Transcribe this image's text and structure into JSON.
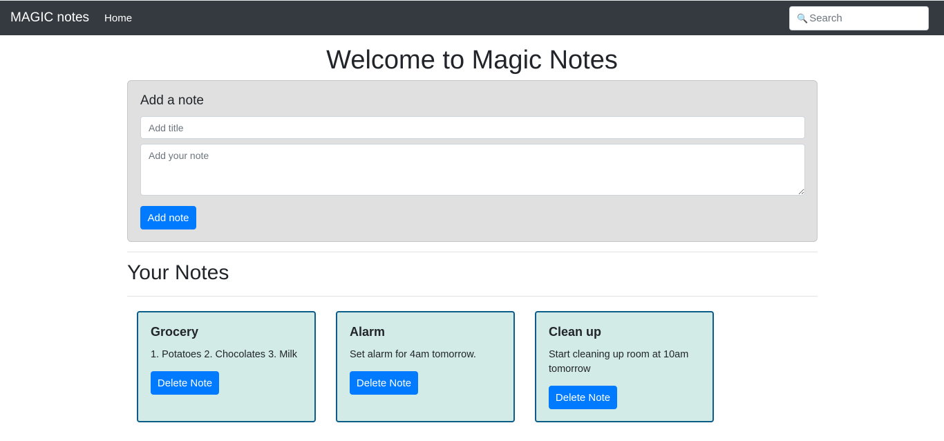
{
  "navbar": {
    "brand": "MAGIC notes",
    "home_label": "Home",
    "search_placeholder": "Search",
    "search_icon": "magnifier-icon"
  },
  "page": {
    "title": "Welcome to Magic Notes"
  },
  "add_note": {
    "heading": "Add a note",
    "title_placeholder": "Add title",
    "note_placeholder": "Add your note",
    "button_label": "Add note"
  },
  "notes_section": {
    "heading": "Your Notes",
    "notes": [
      {
        "title": "Grocery",
        "text": "1. Potatoes 2. Chocolates 3. Milk",
        "button_label": "Delete Note"
      },
      {
        "title": "Alarm",
        "text": "Set alarm for 4am tomorrow.",
        "button_label": "Delete Note"
      },
      {
        "title": "Clean up",
        "text": "Start cleaning up room at 10am tomorrow",
        "button_label": "Delete Note"
      }
    ]
  },
  "colors": {
    "navbar_bg": "#343a40",
    "primary": "#007bff",
    "card_bg": "#d2ebe6",
    "card_border": "#0b5c86",
    "add_panel_bg": "#e0e0e0"
  }
}
